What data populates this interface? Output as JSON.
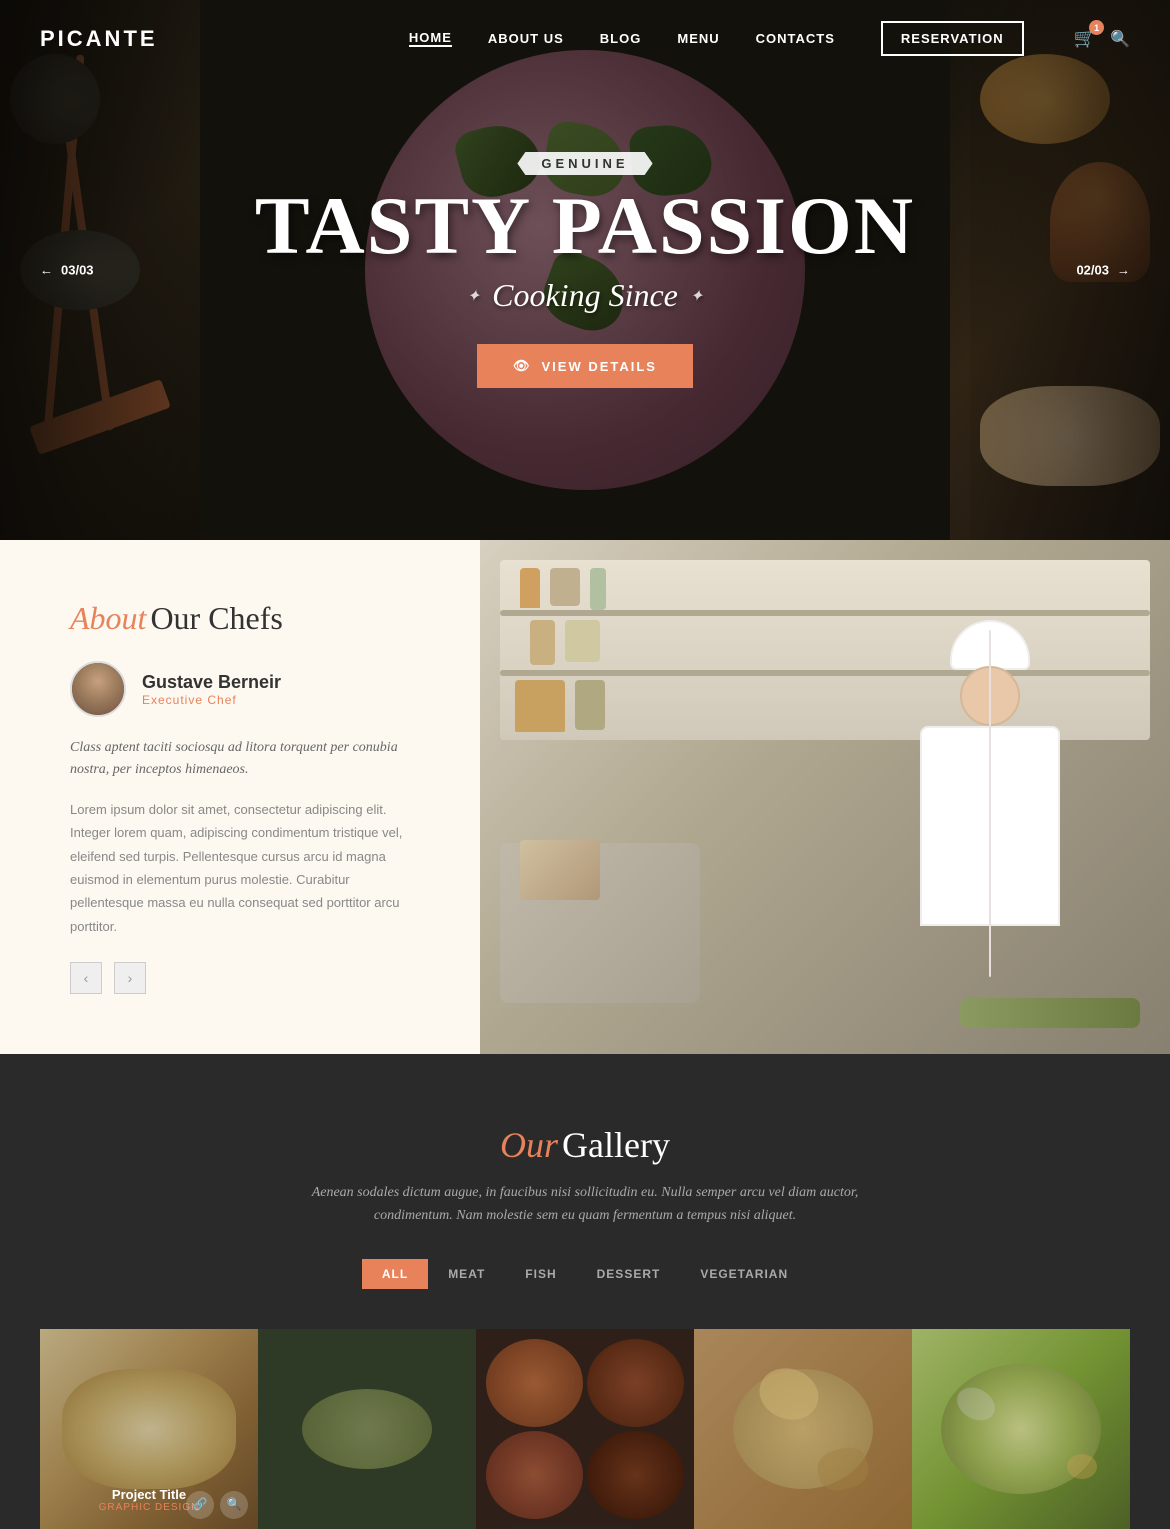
{
  "nav": {
    "logo": "PICANTE",
    "links": [
      {
        "id": "home",
        "label": "HOME",
        "active": true
      },
      {
        "id": "about",
        "label": "ABOUT US",
        "active": false
      },
      {
        "id": "blog",
        "label": "BLOG",
        "active": false
      },
      {
        "id": "menu",
        "label": "MENU",
        "active": false
      },
      {
        "id": "contacts",
        "label": "CONTACTS",
        "active": false
      }
    ],
    "reservation": "RESERVATION",
    "cart_count": "1"
  },
  "hero": {
    "genuine_label": "GENUINE",
    "title": "TASTY PASSION",
    "subtitle": "Cooking Since",
    "cta_label": "VIEW DETAILS",
    "nav_left": "03/03",
    "nav_right": "02/03"
  },
  "about": {
    "heading_italic": "About",
    "heading_regular": "Our Chefs",
    "chef_name": "Gustave Berneir",
    "chef_title": "Executive Chef",
    "quote": "Class aptent taciti sociosqu ad litora torquent per conubia nostra, per inceptos himenaeos.",
    "body": "Lorem ipsum dolor sit amet, consectetur adipiscing elit. Integer lorem quam, adipiscing condimentum tristique vel, eleifend sed turpis. Pellentesque cursus arcu id magna euismod in elementum purus molestie. Curabitur pellentesque massa eu nulla consequat sed porttitor arcu porttitor.",
    "arrow_prev": "‹",
    "arrow_next": "›"
  },
  "gallery": {
    "heading_italic": "Our",
    "heading_regular": "Gallery",
    "subtitle": "Aenean sodales dictum augue, in faucibus nisi sollicitudin eu. Nulla semper arcu vel diam auctor, condimentum.\nNam molestie sem eu quam fermentum a tempus nisi aliquet.",
    "filters": [
      {
        "id": "all",
        "label": "ALL",
        "active": true
      },
      {
        "id": "meat",
        "label": "MEAT",
        "active": false
      },
      {
        "id": "fish",
        "label": "FISH",
        "active": false
      },
      {
        "id": "dessert",
        "label": "DESSERT",
        "active": false
      },
      {
        "id": "vegetarian",
        "label": "VEGETARIAN",
        "active": false
      }
    ],
    "items": [
      {
        "id": 1,
        "title": "Project Title",
        "subtitle": "GRAPHIC DESIGN",
        "color_from": "#e8d4a0",
        "color_to": "#a07840"
      },
      {
        "id": 2,
        "title": "",
        "subtitle": "",
        "color_from": "#3a4830",
        "color_to": "#283520"
      },
      {
        "id": 3,
        "title": "",
        "subtitle": "",
        "color_from": "#8a3030",
        "color_to": "#4a1010"
      },
      {
        "id": 4,
        "title": "",
        "subtitle": "",
        "color_from": "#c4903a",
        "color_to": "#705020"
      },
      {
        "id": 5,
        "title": "",
        "subtitle": "",
        "color_from": "#a0c060",
        "color_to": "#506030"
      }
    ]
  }
}
